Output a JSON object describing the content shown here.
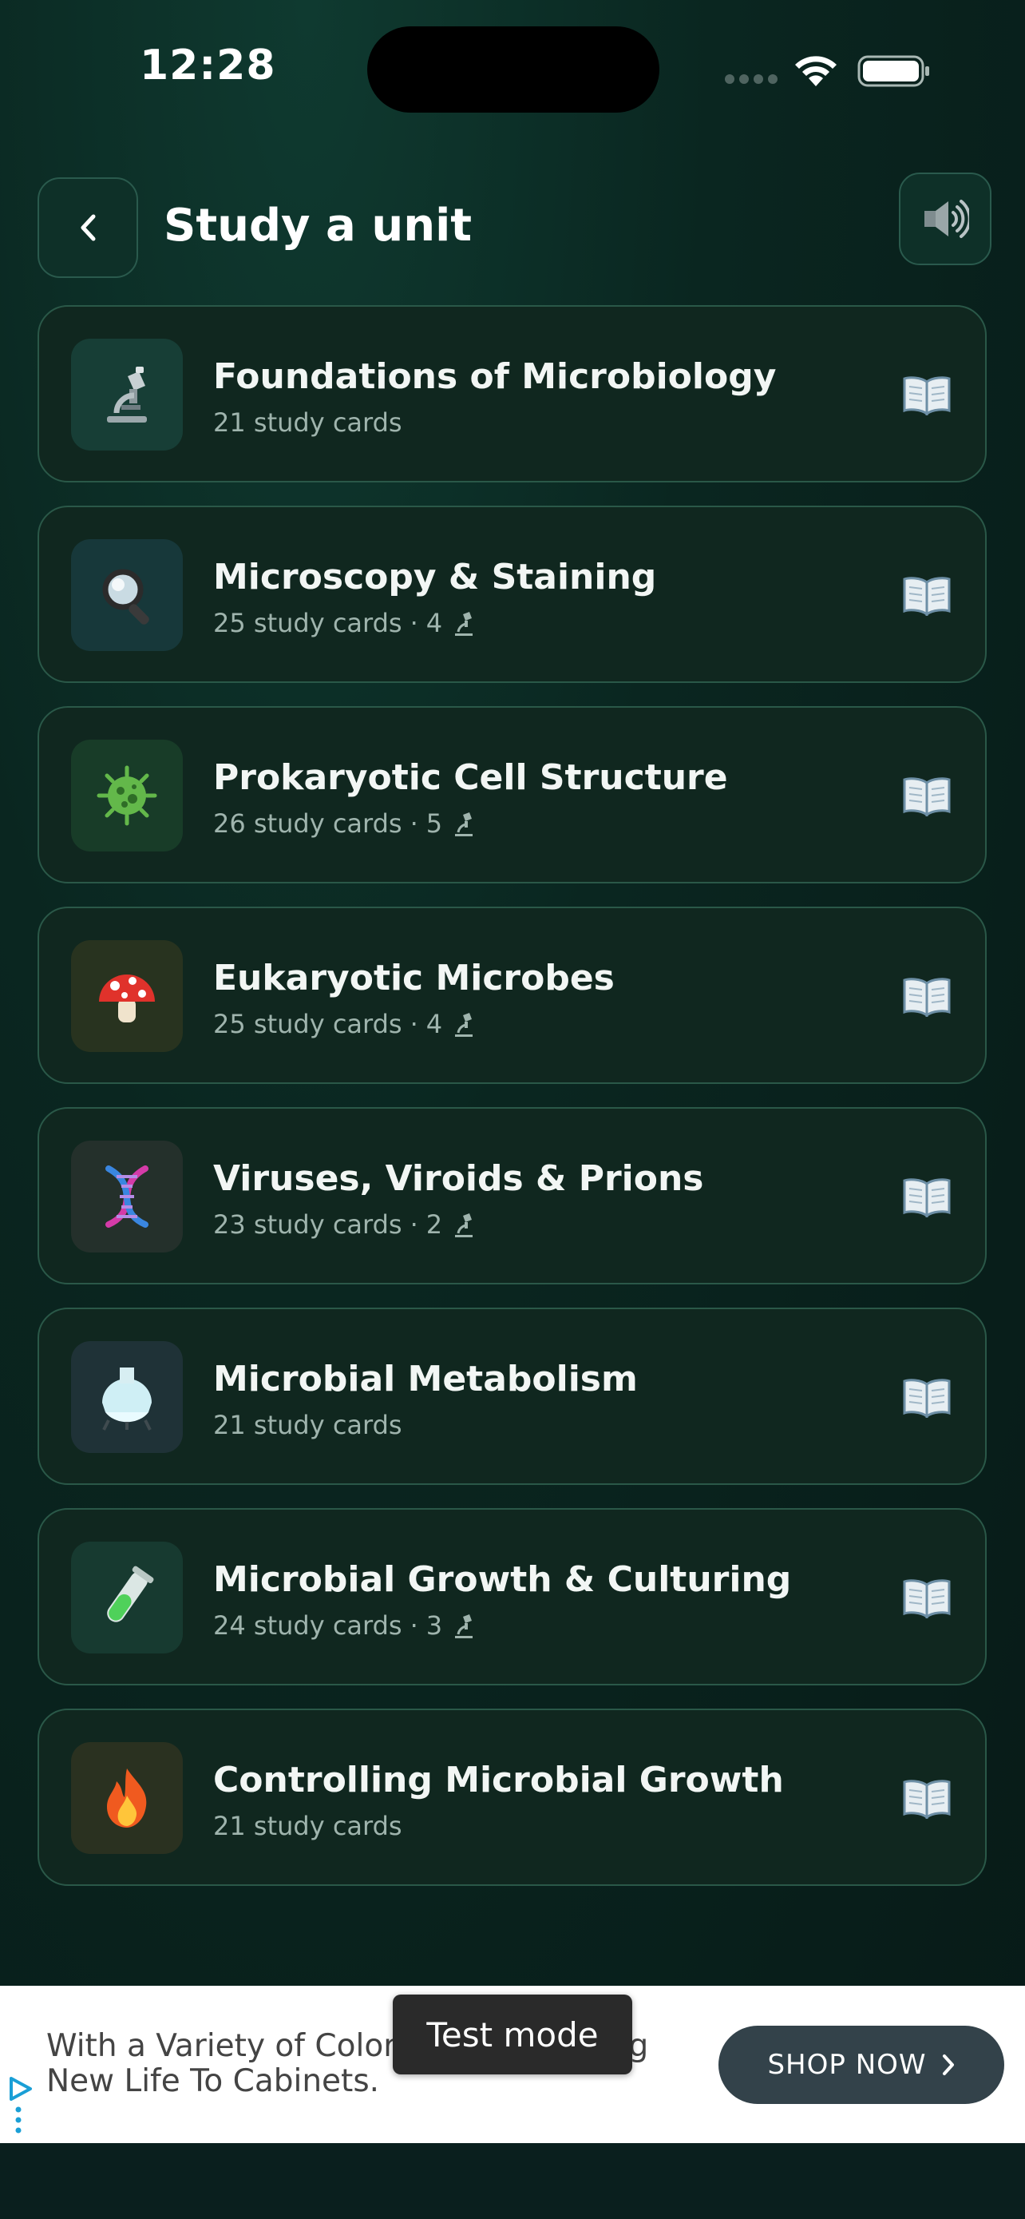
{
  "status_bar": {
    "time": "12:28"
  },
  "header": {
    "title": "Study a unit",
    "back_icon": "chevron-left-icon",
    "sound_icon": "speaker-icon"
  },
  "units": [
    {
      "title": "Foundations of Microbiology",
      "cards": "21 study cards",
      "labs": "",
      "icon": "microscope-icon",
      "tile_color": "#173e36"
    },
    {
      "title": "Microscopy & Staining",
      "cards": "25 study cards",
      "labs": "4",
      "icon": "magnifying-glass-icon",
      "tile_color": "#17383a"
    },
    {
      "title": "Prokaryotic Cell Structure",
      "cards": "26 study cards",
      "labs": "5",
      "icon": "microbe-icon",
      "tile_color": "#183c28"
    },
    {
      "title": "Eukaryotic Microbes",
      "cards": "25 study cards",
      "labs": "4",
      "icon": "mushroom-icon",
      "tile_color": "#28331f"
    },
    {
      "title": "Viruses, Viroids & Prions",
      "cards": "23 study cards",
      "labs": "2",
      "icon": "dna-icon",
      "tile_color": "#24302b"
    },
    {
      "title": "Microbial Metabolism",
      "cards": "21 study cards",
      "labs": "",
      "icon": "flask-icon",
      "tile_color": "#1f3237"
    },
    {
      "title": "Microbial Growth & Culturing",
      "cards": "24 study cards",
      "labs": "3",
      "icon": "test-tube-icon",
      "tile_color": "#173a30"
    },
    {
      "title": "Controlling Microbial Growth",
      "cards": "21 study cards",
      "labs": "",
      "icon": "fire-icon",
      "tile_color": "#2a3120"
    }
  ],
  "meta_separator": "·",
  "ad": {
    "text": "With a Variety of Colors, You Can Bring New Life To Cabinets.",
    "button_label": "SHOP NOW",
    "badge": "Test mode"
  },
  "colors": {
    "accent": "#2a5848",
    "card_bg": "#10271f",
    "shop_button": "#33424a"
  }
}
